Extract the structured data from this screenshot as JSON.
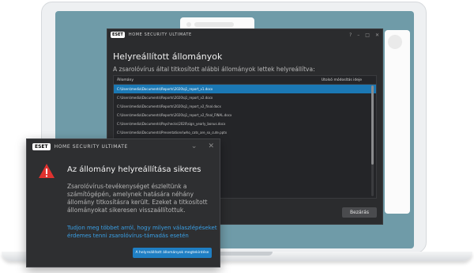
{
  "main_window": {
    "app_title": "HOME SECURITY ULTIMATE",
    "logo": "ESET",
    "title": "Helyreállított állományok",
    "subtitle": "A zsarolóvírus által titkosított alábbi állományok lettek helyreállítva:",
    "table": {
      "col_file": "Állomány",
      "col_modified": "Utolsó módosítás ideje",
      "rows": [
        "C:\\Users\\media\\Documents\\Reports\\2020\\q1_report_v1.docx",
        "C:\\Users\\media\\Documents\\Reports\\2020\\q1_report_v2.docx",
        "C:\\Users\\media\\Documents\\Reports\\2020\\q1_report_v2_final.docx",
        "C:\\Users\\media\\Documents\\Reports\\2020\\q1_report_v2_final_FINAL.docx",
        "C:\\Users\\media\\Documents\\Paychecks\\2020\\sign_yearly_bonus.docx",
        "C:\\Users\\media\\Documents\\Presentations\\who_cats_are_so_cute.pptx",
        "C:\\Users\\media\\Documents\\...\\_promote_me.pptx",
        "",
        "C:\\Users\\media\\Documents\\...\\_brainstorming_v3.docx",
        "C:\\Users\\media\\Documents\\...\\cation_request.pdf",
        "C:\\Users\\media\\Documents\\...\\esignation_letter.pdf",
        "C:\\Users\\media\\Documents\\...\\_team_dinner_meeting_notes.txt",
        "C:\\Users\\media\\Documents\\...\\_notes_meeting_notes.docx"
      ]
    },
    "close_button": "Bezárás"
  },
  "notification": {
    "logo": "ESET",
    "app_title": "HOME SECURITY ULTIMATE",
    "title": "Az állomány helyreállítása sikeres",
    "body": "Zsarolóvírus-tevékenységet észleltünk a számítógépén, amelynek hatására néhány állomány titkosításra került. Ezeket a titkosított állományokat sikeresen visszaállítottuk.",
    "link": "Tudjon meg többet arról, hogy milyen válaszlépéseket érdemes tenni zsarolóvírus-támadás esetén",
    "button": "A helyreállított állományok megtekintése"
  },
  "colors": {
    "accent": "#1f7fc4",
    "warning": "#e0322f",
    "window_bg": "#2b2c2e"
  }
}
